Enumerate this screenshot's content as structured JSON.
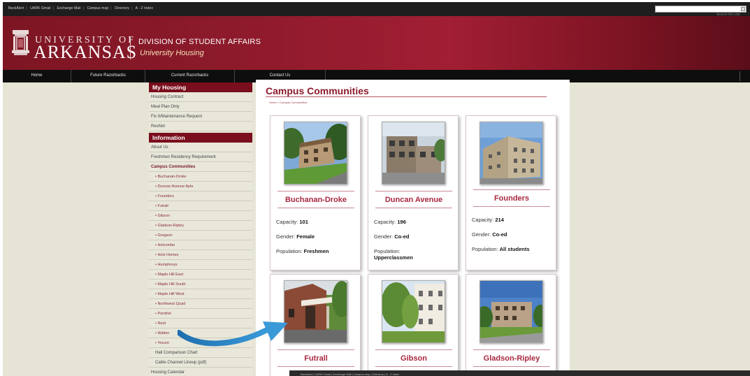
{
  "utility": {
    "links": [
      "BackAlert",
      "UARK Gmail",
      "Exchange Mail",
      "Campus map",
      "Directory",
      "A - Z Index"
    ],
    "search_placeholder": "Search this site"
  },
  "banner": {
    "university_line1": "UNIVERSITY OF",
    "university_line2": "ARKANSAS",
    "division": "DIVISION OF STUDENT AFFAIRS",
    "subdivision": "University Housing"
  },
  "nav": [
    "Home",
    "Future Razorbacks",
    "Current Razorbacks",
    "Contact Us"
  ],
  "sidebar": {
    "my_housing_title": "My Housing",
    "my_housing": [
      "Housing Contract",
      "Meal Plan Only",
      "Fix It/Maintenance Request",
      "ResNet"
    ],
    "information_title": "Information",
    "information": [
      "About Us",
      "Freshmen Residency Requirement"
    ],
    "communities_title": "Campus Communities",
    "communities": [
      "• Buchanan-Droke",
      "• Duncan Avenue Apts",
      "• Founders",
      "• Futrall",
      "• Gibson",
      "• Gladson-Ripley",
      "• Gregson",
      "• Holcombe",
      "• Holz Homes",
      "• Humphreys",
      "• Maple Hill East",
      "• Maple Hill South",
      "• Maple Hill West",
      "• Northwest Quad",
      "• Pomfret",
      "• Reid",
      "• Walton",
      "• Yocum"
    ],
    "extras": [
      "Hall Comparison Chart",
      "Cable Channel Lineup (pdf)",
      "Housing Calendar"
    ]
  },
  "main": {
    "title": "Campus Communities",
    "breadcrumb": "Home » Campus Communities",
    "labels": {
      "capacity": "Capacity:",
      "gender": "Gender:",
      "population": "Population:"
    },
    "cards": [
      {
        "name": "Buchanan-Droke",
        "capacity": "101",
        "gender": "Female",
        "population": "Freshmen"
      },
      {
        "name": "Duncan Avenue",
        "capacity": "196",
        "gender": "Co-ed",
        "population": "Upperclassmen"
      },
      {
        "name": "Founders",
        "capacity": "214",
        "gender": "Co-ed",
        "population": "All students"
      },
      {
        "name": "Futrall"
      },
      {
        "name": "Gibson"
      },
      {
        "name": "Gladson-Ripley"
      }
    ]
  },
  "colors": {
    "accent": "#8b1a2b",
    "banner": "#8c1a2a",
    "sidebar_bg": "#e8e7d9",
    "arrow": "#2a86c8"
  }
}
